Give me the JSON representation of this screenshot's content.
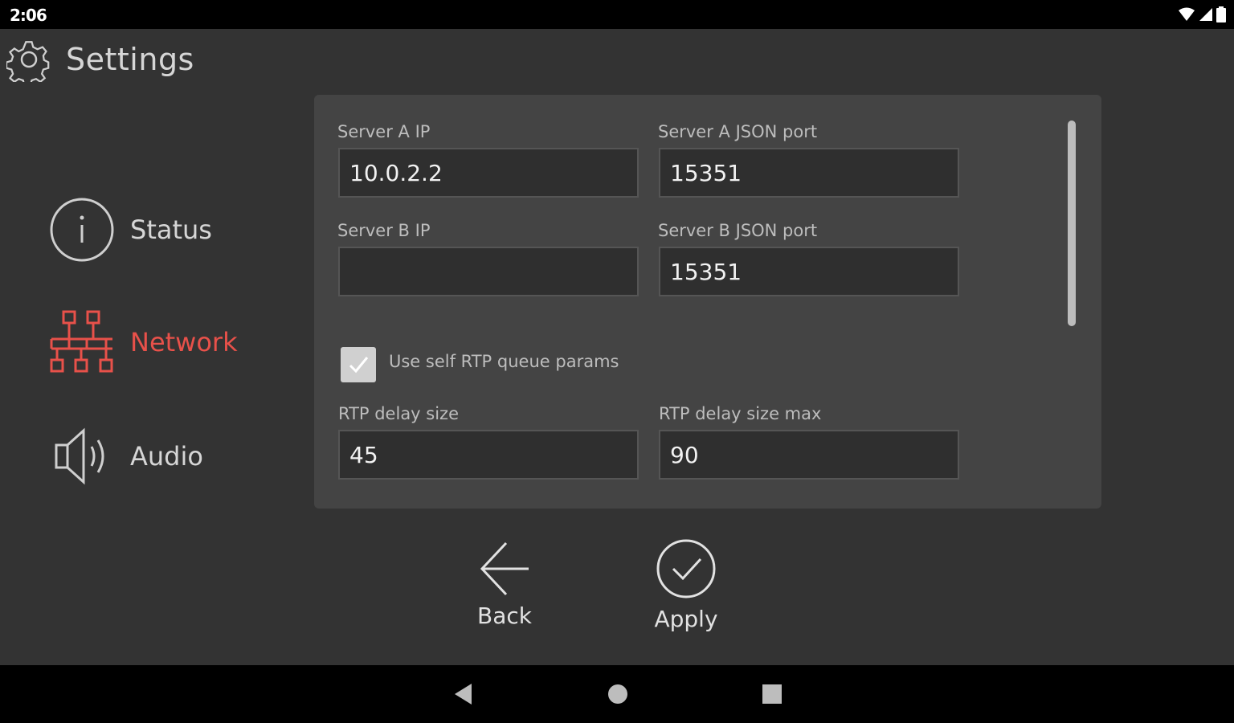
{
  "status_bar": {
    "time": "2:06"
  },
  "header": {
    "title": "Settings",
    "icon": "gear-icon"
  },
  "sidebar": {
    "items": [
      {
        "label": "Status",
        "icon": "info-icon",
        "active": false
      },
      {
        "label": "Network",
        "icon": "network-icon",
        "active": true
      },
      {
        "label": "Audio",
        "icon": "speaker-icon",
        "active": false
      }
    ]
  },
  "form": {
    "server_a_ip": {
      "label": "Server A IP",
      "value": "10.0.2.2"
    },
    "server_a_port": {
      "label": "Server A JSON port",
      "value": "15351"
    },
    "server_b_ip": {
      "label": "Server B IP",
      "value": ""
    },
    "server_b_port": {
      "label": "Server B JSON port",
      "value": "15351"
    },
    "use_self_rtp": {
      "label": "Use self RTP queue params",
      "checked": true
    },
    "rtp_delay_size": {
      "label": "RTP delay size",
      "value": "45"
    },
    "rtp_delay_size_max": {
      "label": "RTP delay size max",
      "value": "90"
    }
  },
  "actions": {
    "back_label": "Back",
    "apply_label": "Apply"
  },
  "colors": {
    "accent": "#e8514a",
    "background": "#333333",
    "panel": "#444444"
  }
}
